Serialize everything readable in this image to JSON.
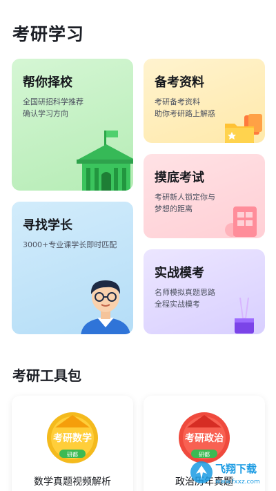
{
  "header": {
    "title": "考研学习"
  },
  "cards": {
    "school": {
      "title": "帮你择校",
      "desc": [
        "全国研招科学推荐",
        "确认学习方向"
      ],
      "icon": "school-building-icon"
    },
    "senior": {
      "title": "寻找学长",
      "desc": [
        "3000+专业课学长即时匹配"
      ],
      "icon": "student-avatar-icon"
    },
    "material": {
      "title": "备考资料",
      "desc": [
        "考研备考资料",
        "助你考研路上解惑"
      ],
      "icon": "folder-files-icon"
    },
    "diagnostic": {
      "title": "摸底考试",
      "desc": [
        "考研新人锁定你与",
        "梦想的距离"
      ],
      "icon": "exam-paper-icon"
    },
    "mock": {
      "title": "实战模考",
      "desc": [
        "名师模拟真题思路",
        "全程实战模考"
      ],
      "icon": "test-tube-icon"
    }
  },
  "toolkit": {
    "title": "考研工具包",
    "items": [
      {
        "label": "数学真题视频解析",
        "badge": "考研数学",
        "sub": "研都",
        "color": "#f2b318"
      },
      {
        "label": "政治历年真题",
        "badge": "考研政治",
        "sub": "研都",
        "color": "#e8403a"
      }
    ]
  },
  "watermark": {
    "text": "飞翔下载",
    "url": "www.fxxz.com"
  }
}
